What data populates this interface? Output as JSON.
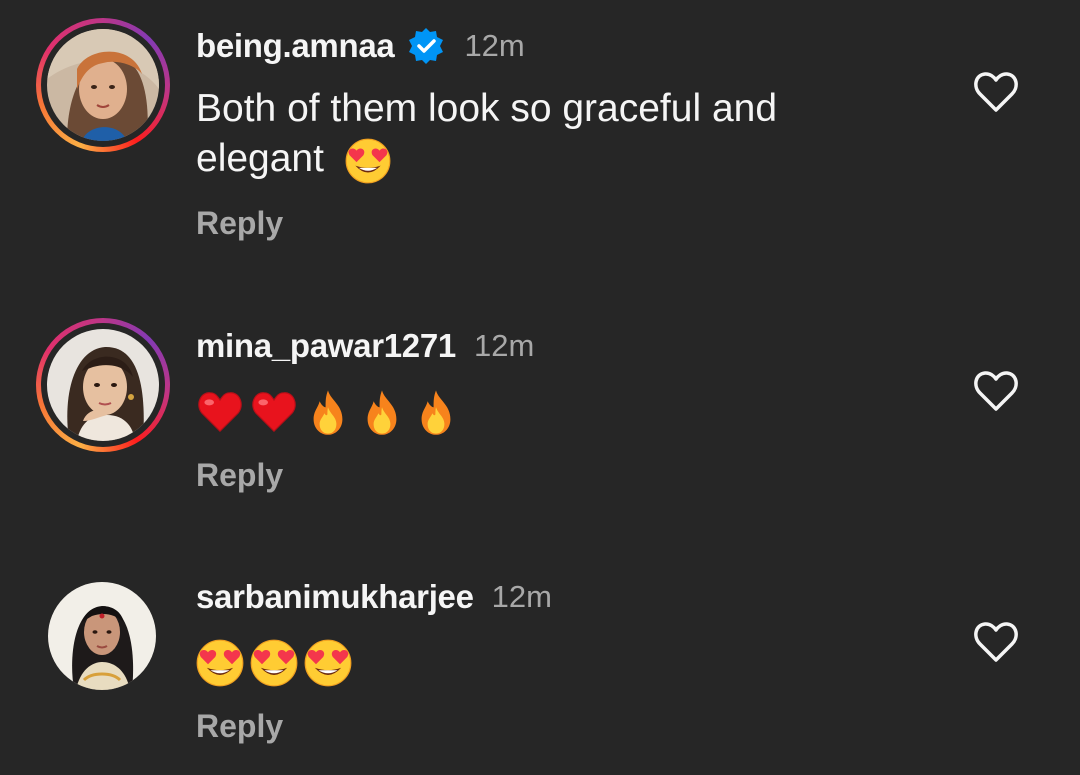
{
  "comments": [
    {
      "username": "being.amnaa",
      "verified": true,
      "time": "12m",
      "text": "Both of them look so graceful and elegant",
      "emojis": [
        "heart-eyes"
      ],
      "reply_label": "Reply",
      "liked": false,
      "has_story_ring": true
    },
    {
      "username": "mina_pawar1271",
      "verified": false,
      "time": "12m",
      "text": "",
      "emojis": [
        "red-heart",
        "red-heart",
        "fire",
        "fire",
        "fire"
      ],
      "reply_label": "Reply",
      "liked": false,
      "has_story_ring": true
    },
    {
      "username": "sarbanimukharjee",
      "verified": false,
      "time": "12m",
      "text": "",
      "emojis": [
        "heart-eyes",
        "heart-eyes",
        "heart-eyes"
      ],
      "reply_label": "Reply",
      "liked": false,
      "has_story_ring": false
    }
  ],
  "colors": {
    "background": "#262626",
    "primary_text": "#f5f5f5",
    "secondary_text": "#a8a8a8",
    "verified_blue": "#0095f6"
  }
}
